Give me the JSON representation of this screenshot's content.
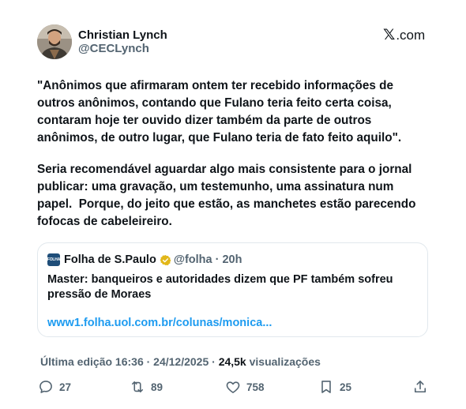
{
  "author": {
    "name": "Christian Lynch",
    "handle": "@CECLynch"
  },
  "brand": {
    "glyph": "𝕏",
    "label": ".com"
  },
  "tweet": {
    "paragraphs": [
      "\"Anônimos que afirmaram ontem ter recebido informações de\noutros anônimos, contando que Fulano teria feito certa coisa,\ncontaram hoje ter ouvido dizer também da parte de outros\nanônimos, de outro lugar, que Fulano teria de fato feito aquilo\".",
      "Seria recomendável aguardar algo mais consistente para o jornal\npublicar: uma gravação, um testemunho, uma assinatura num\npapel.  Porque, do jeito que estão, as manchetes estão parecendo\nfofocas de cabeleireiro."
    ]
  },
  "quote": {
    "logo_text": "FOLHA",
    "name": "Folha de S.Paulo",
    "meta": "@folha · 20h",
    "text": "Master: banqueiros e autoridades dizem que PF também sofreu\npressão de Moraes",
    "link": "www1.folha.uol.com.br/colunas/monica..."
  },
  "meta": {
    "edited": "Última edição 16:36 · 24/12/2025 · ",
    "views_count": "24,5k",
    "views_label": " visualizações"
  },
  "actions": {
    "replies": "27",
    "retweets": "89",
    "likes": "758",
    "bookmarks": "25"
  },
  "colors": {
    "text": "#0f1419",
    "secondary": "#536471",
    "link": "#1d9bf0",
    "verified_gold": "#e2b719"
  },
  "icons": [
    "reply-icon",
    "retweet-icon",
    "like-icon",
    "bookmark-icon",
    "share-icon",
    "verified-icon"
  ]
}
